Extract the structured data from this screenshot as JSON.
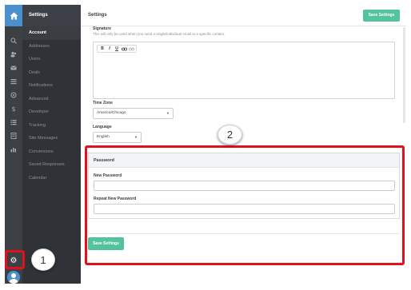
{
  "rail": {
    "icons": [
      "home-icon",
      "search-icon",
      "contacts-icon",
      "inbox-icon",
      "list-icon",
      "deals-icon",
      "dollar-icon",
      "tasks-icon",
      "reports-icon",
      "chart-icon"
    ],
    "gear": "⚙"
  },
  "menu": {
    "header": "Settings",
    "items": [
      {
        "label": "Account",
        "active": true
      },
      {
        "label": "Addresses"
      },
      {
        "label": "Users"
      },
      {
        "label": "Deals"
      },
      {
        "label": "Notifications"
      },
      {
        "label": "Advanced"
      },
      {
        "label": "Developer"
      },
      {
        "label": "Tracking"
      },
      {
        "label": "Site Messages"
      },
      {
        "label": "Conversions"
      },
      {
        "label": "Saved Responses"
      },
      {
        "label": "Calendar"
      }
    ]
  },
  "header": {
    "title": "Settings",
    "save_label": "Save Settings"
  },
  "signature": {
    "label": "Signature",
    "help": "This will only be used when you send a single/individual email to a specific contact.",
    "toolbar": [
      "B",
      "I",
      "U",
      "🔗",
      "⛓"
    ]
  },
  "timezone": {
    "label": "Time Zone",
    "value": "America/Chicago"
  },
  "language": {
    "label": "Language",
    "value": "English"
  },
  "password": {
    "section_title": "Password",
    "new_label": "New Password",
    "repeat_label": "Repeat New Password",
    "new_value": "",
    "repeat_value": ""
  },
  "footer": {
    "save_label": "Save Settings"
  },
  "callouts": {
    "one": "1",
    "two": "2"
  },
  "colors": {
    "accent": "#4a90cd",
    "button": "#52c39a",
    "highlight": "#e0101d"
  }
}
